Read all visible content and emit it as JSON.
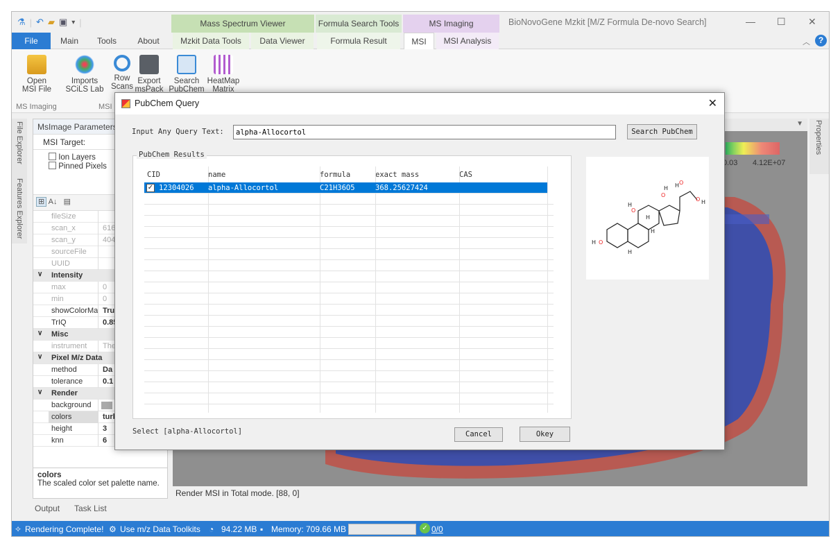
{
  "titlebar": {
    "app_title": "BioNovoGene Mzkit [M/Z Formula De-novo Search]",
    "context_tabs": [
      "Mass Spectrum Viewer",
      "Formula Search Tools",
      "MS Imaging"
    ]
  },
  "ribbon_tabs": [
    "File",
    "Main",
    "Tools",
    "About",
    "Mzkit Data Tools",
    "Data Viewer",
    "Formula Result",
    "MSI",
    "MSI Analysis"
  ],
  "ribbon": {
    "buttons": [
      {
        "l1": "Open",
        "l2": "MSI File"
      },
      {
        "l1": "Imports",
        "l2": "SCiLS Lab"
      },
      {
        "l1": "Row",
        "l2": "Scans"
      },
      {
        "l1": "Export",
        "l2": "msPack"
      },
      {
        "l1": "Search",
        "l2": "PubChem"
      },
      {
        "l1": "HeatMap",
        "l2": "Matrix"
      }
    ],
    "groups": [
      "MS Imaging",
      "MSI"
    ]
  },
  "side_tabs": [
    "File Explorer",
    "Features Explorer"
  ],
  "right_tab": "Properties",
  "left_panel": {
    "title": "MsImage Parameters",
    "target_label": "MSI Target:",
    "layers": [
      "Ion Layers",
      "Pinned Pixels"
    ],
    "props": [
      {
        "k": "fileSize",
        "v": "",
        "dim": true
      },
      {
        "k": "scan_x",
        "v": "616",
        "dim": true
      },
      {
        "k": "scan_y",
        "v": "404",
        "dim": true
      },
      {
        "k": "sourceFile",
        "v": "",
        "dim": true
      },
      {
        "k": "UUID",
        "v": "",
        "dim": true
      },
      {
        "cat": "Intensity"
      },
      {
        "k": "max",
        "v": "0",
        "dim": true
      },
      {
        "k": "min",
        "v": "0",
        "dim": true
      },
      {
        "k": "showColorMap",
        "v": "Tru",
        "bold": true
      },
      {
        "k": "TrIQ",
        "v": "0.85",
        "bold": true
      },
      {
        "cat": "Misc"
      },
      {
        "k": "instrument",
        "v": "Ther",
        "dim": true
      },
      {
        "cat": "Pixel M/z Data"
      },
      {
        "k": "method",
        "v": "Da",
        "bold": true
      },
      {
        "k": "tolerance",
        "v": "0.1",
        "bold": true
      },
      {
        "cat": "Render"
      },
      {
        "k": "background",
        "v": "",
        "swatch": true
      },
      {
        "k": "colors",
        "v": "turb",
        "bold": true,
        "sel": true
      },
      {
        "k": "height",
        "v": "3",
        "bold": true
      },
      {
        "k": "knn",
        "v": "6",
        "bold": true
      }
    ],
    "desc_title": "colors",
    "desc_text": "The scaled color set palette name."
  },
  "canvas": {
    "legend_min": "0.03",
    "legend_max": "4.12E+07",
    "status": "Render MSI in Total mode.  [88, 0]"
  },
  "bottom_tabs": [
    "Output",
    "Task List"
  ],
  "statusbar": {
    "msg": "Rendering Complete!",
    "toolkit": "Use m/z Data Toolkits",
    "mem1": "94.22 MB",
    "memory": "Memory: 709.66 MB",
    "tasks": "0/0"
  },
  "dialog": {
    "title": "PubChem Query",
    "query_label": "Input Any Query Text:",
    "query_value": "alpha-Allocortol",
    "search_btn": "Search PubChem",
    "results_title": "PubChem Results",
    "columns": [
      "CID",
      "name",
      "formula",
      "exact mass",
      "CAS"
    ],
    "rows": [
      {
        "cid": "12304026",
        "name": "alpha-Allocortol",
        "formula": "C21H36O5",
        "mass": "368.25627424",
        "cas": ""
      }
    ],
    "select_text": "Select [alpha-Allocortol]",
    "cancel": "Cancel",
    "okey": "Okey"
  },
  "colors": {
    "accent": "#2b7cd3",
    "selection": "#0078d7",
    "tissue": "#b85a52"
  }
}
